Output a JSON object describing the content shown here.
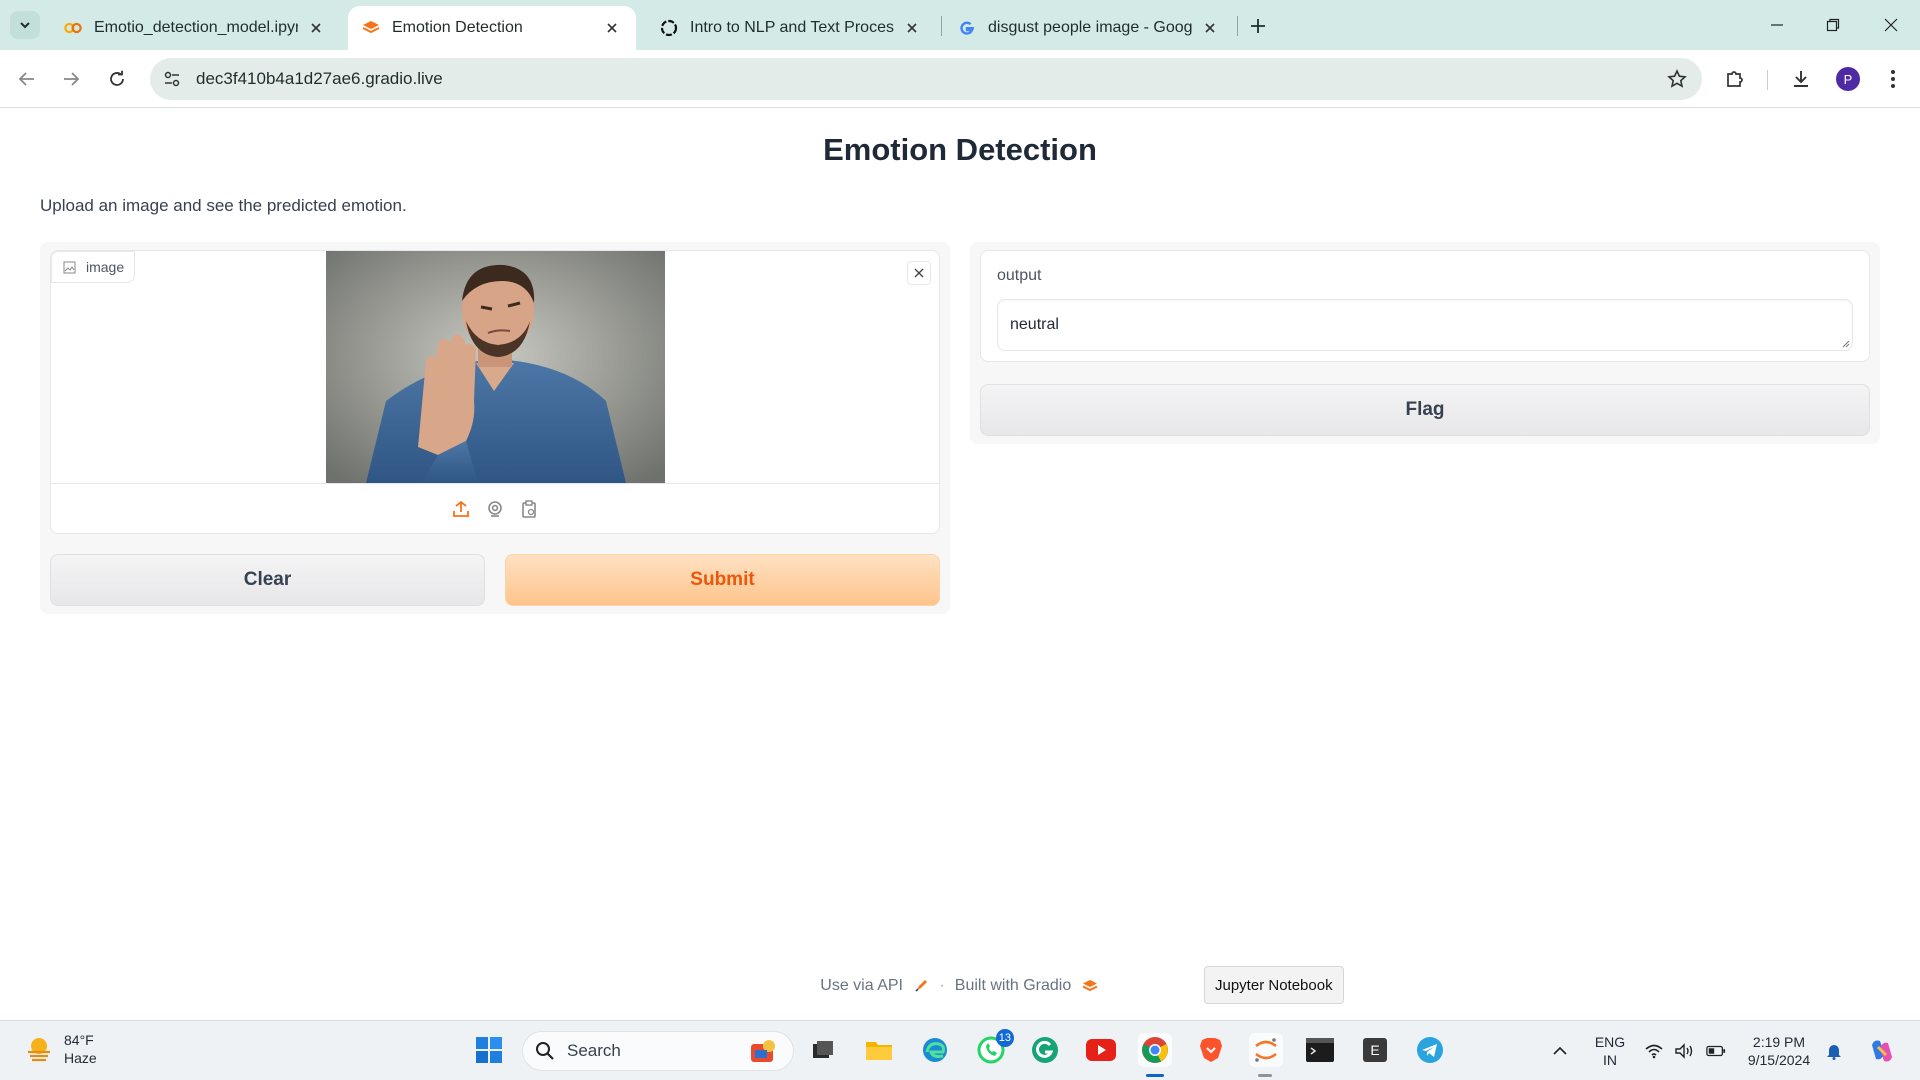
{
  "browser": {
    "tabs": [
      {
        "title": "Emotio_detection_model.ipynb",
        "favicon": "colab-icon"
      },
      {
        "title": "Emotion Detection",
        "favicon": "gradio-icon",
        "active": true
      },
      {
        "title": "Intro to NLP and Text Processing",
        "favicon": "openai-icon"
      },
      {
        "title": "disgust people image - Google",
        "favicon": "google-icon"
      }
    ],
    "url": "dec3f410b4a1d27ae6.gradio.live",
    "profile_initial": "P"
  },
  "page": {
    "title": "Emotion Detection",
    "description": "Upload an image and see the predicted emotion."
  },
  "input": {
    "image_label": "image",
    "clear_label": "Clear",
    "submit_label": "Submit"
  },
  "output": {
    "label": "output",
    "value": "neutral",
    "flag_label": "Flag"
  },
  "footer": {
    "api_label": "Use via API",
    "separator": "·",
    "built_with": "Built with Gradio"
  },
  "tooltip": "Jupyter Notebook",
  "taskbar": {
    "weather_temp": "84°F",
    "weather_desc": "Haze",
    "search_placeholder": "Search",
    "whatsapp_badge": "13",
    "lang_line1": "ENG",
    "lang_line2": "IN",
    "time": "2:19 PM",
    "date": "9/15/2024",
    "e_app_letter": "E"
  },
  "colors": {
    "accent": "#f97316",
    "submit_bg": "#fdc48b",
    "tabbar_bg": "#d3eae6"
  }
}
